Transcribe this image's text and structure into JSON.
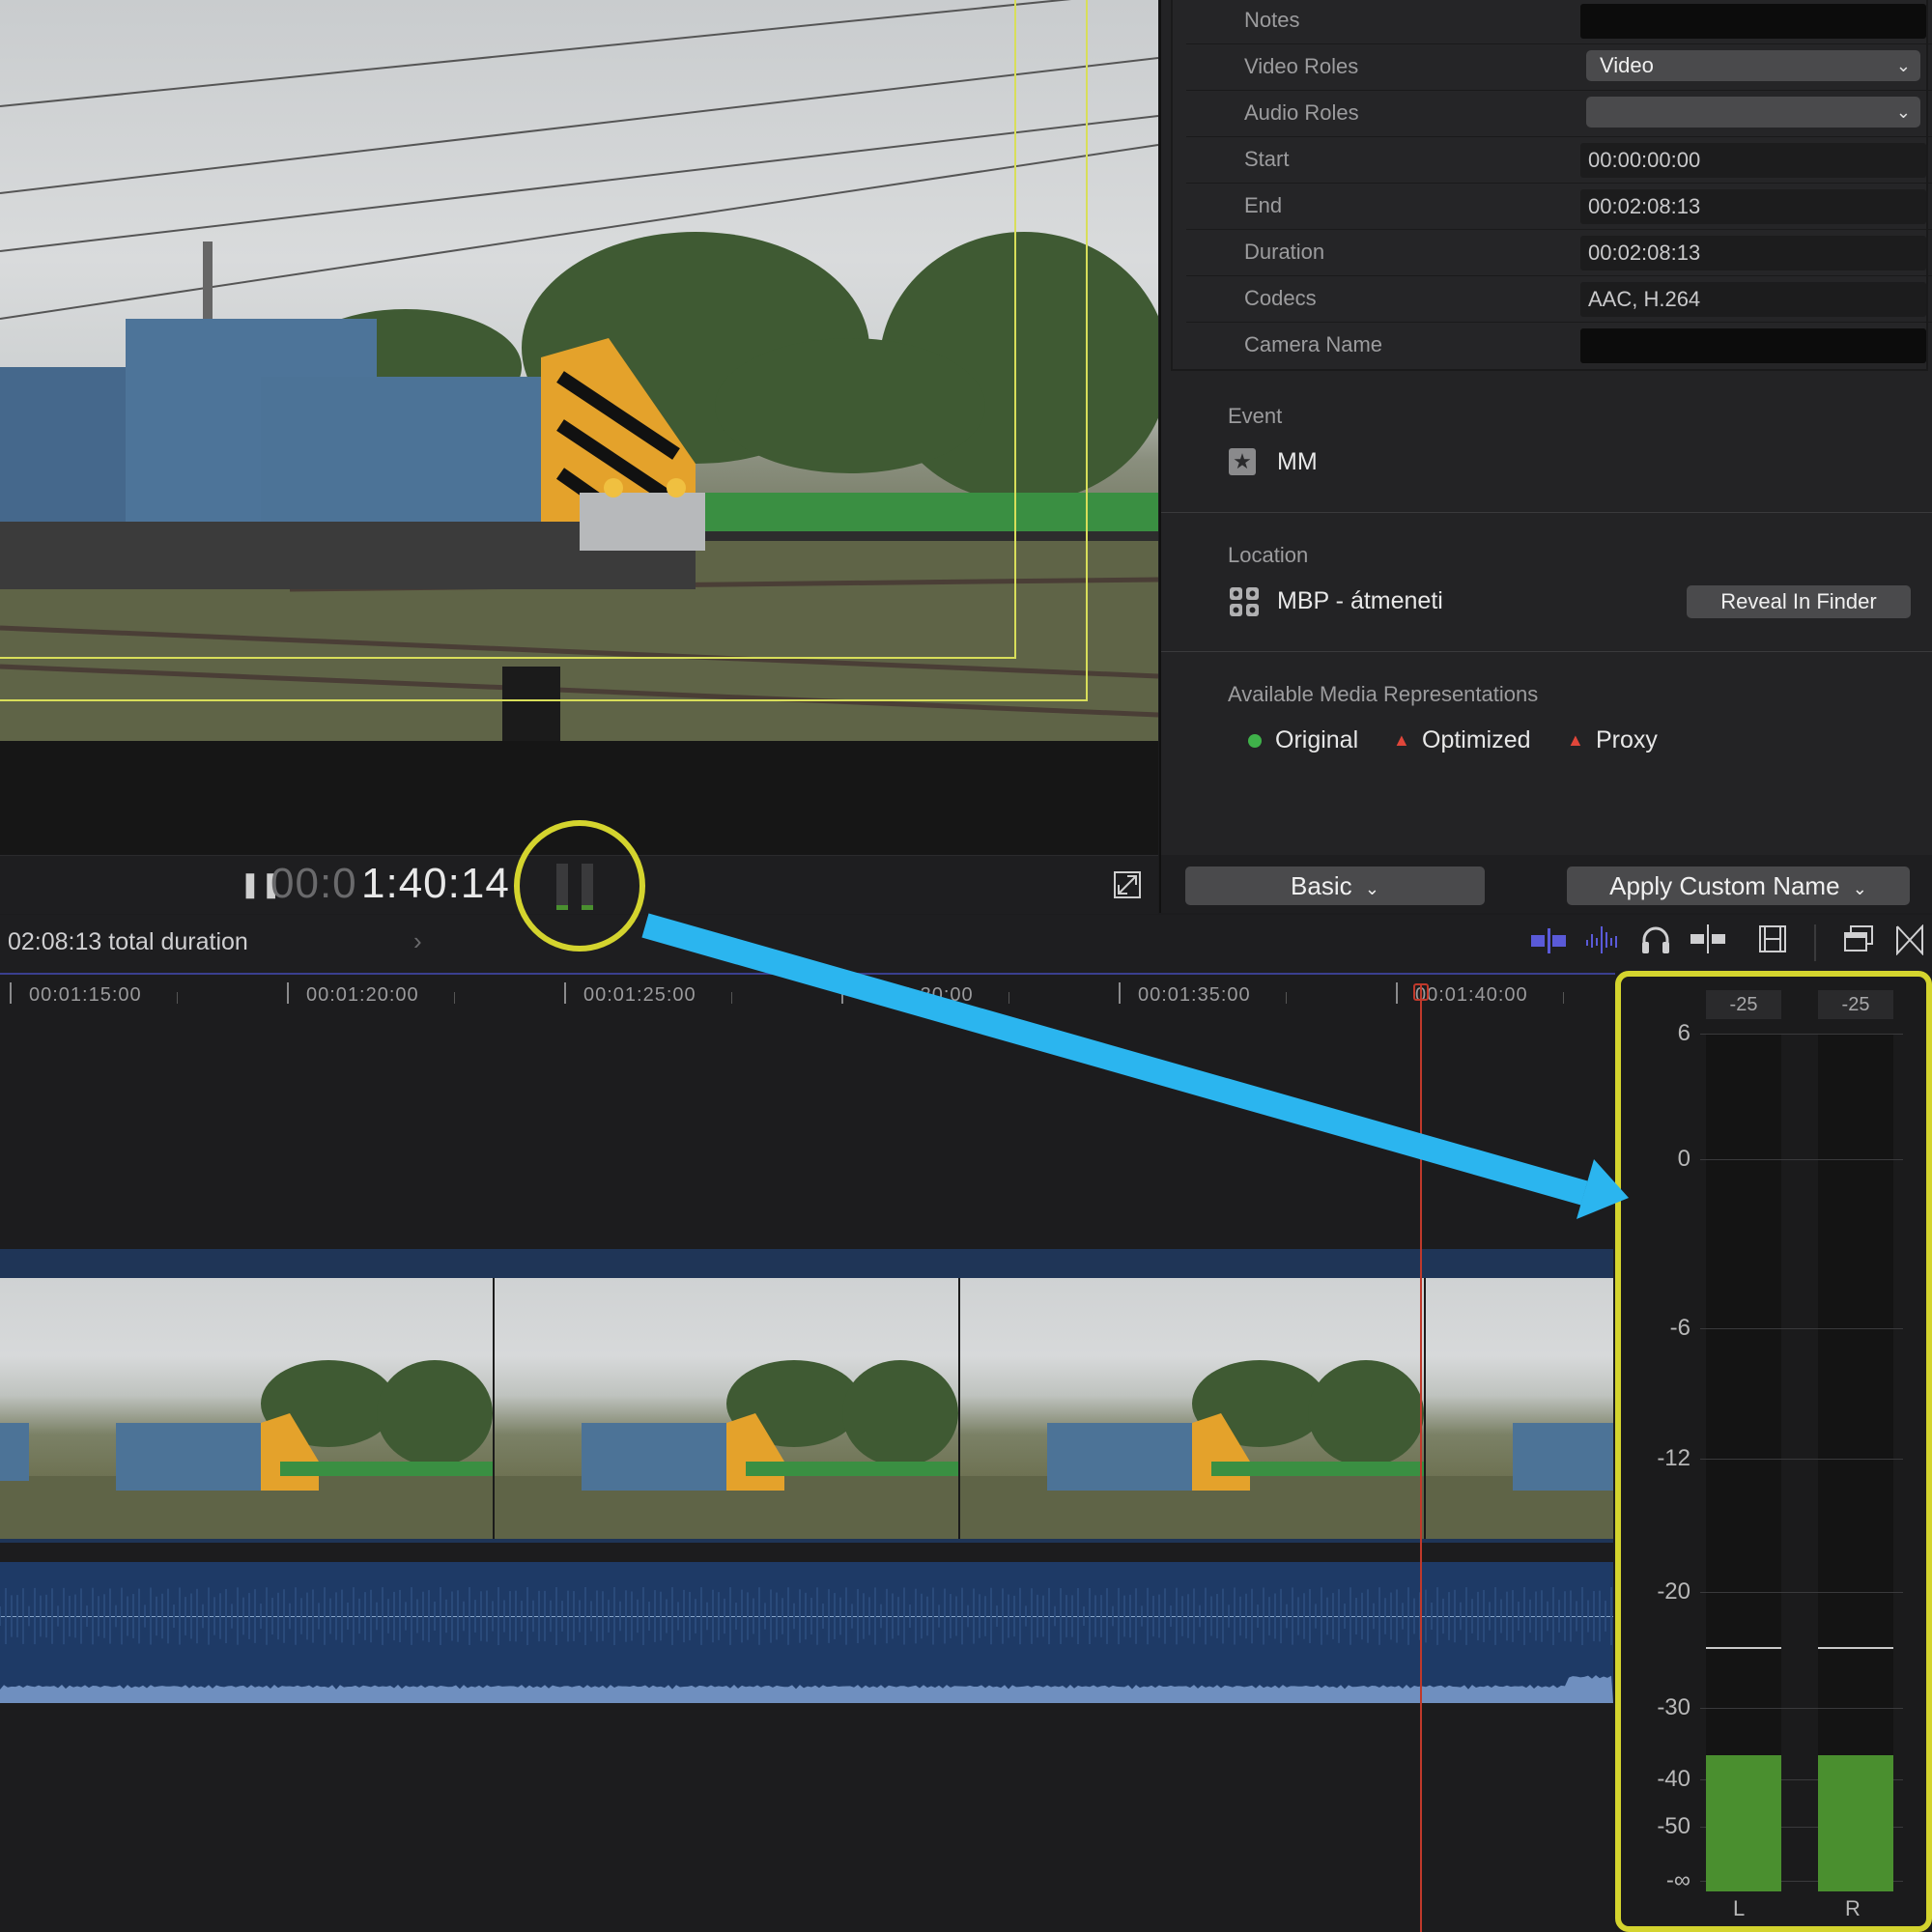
{
  "viewer": {
    "timecode_dim": "00:0",
    "timecode_bright": "1:40:14",
    "fit_icon": "expand-icon",
    "play_icon": "pause-icon"
  },
  "inspector": {
    "rows": [
      {
        "label": "Notes",
        "value": "",
        "kind": "dark"
      },
      {
        "label": "Video Roles",
        "value": "Video",
        "kind": "select"
      },
      {
        "label": "Audio Roles",
        "value": "",
        "kind": "select"
      },
      {
        "label": "Start",
        "value": "00:00:00:00",
        "kind": "field"
      },
      {
        "label": "End",
        "value": "00:02:08:13",
        "kind": "field"
      },
      {
        "label": "Duration",
        "value": "00:02:08:13",
        "kind": "field"
      },
      {
        "label": "Codecs",
        "value": "AAC, H.264",
        "kind": "field"
      },
      {
        "label": "Camera Name",
        "value": "",
        "kind": "dark"
      }
    ],
    "event": {
      "title": "Event",
      "name": "MM"
    },
    "location": {
      "title": "Location",
      "name": "MBP - átmeneti",
      "button": "Reveal In Finder"
    },
    "representations": {
      "title": "Available Media Representations",
      "items": [
        {
          "label": "Original",
          "status": "available",
          "color": "#3fb24a"
        },
        {
          "label": "Optimized",
          "status": "missing",
          "color": "#e0463a"
        },
        {
          "label": "Proxy",
          "status": "missing",
          "color": "#e0463a"
        }
      ]
    },
    "footer": {
      "basic": "Basic",
      "apply": "Apply Custom Name"
    }
  },
  "timeline": {
    "duration_text": "02:08:13 total duration",
    "ruler": [
      "00:01:15:00",
      "00:01:20:00",
      "00:01:25:00",
      "00:01:30:00",
      "00:01:35:00",
      "00:01:40:00"
    ],
    "toolbar_icons": [
      "clip-appearance-icon",
      "audio-skimming-icon",
      "headphones-icon",
      "snapping-icon",
      "filmstrip-icon",
      "window-icon",
      "transitions-icon"
    ]
  },
  "meters": {
    "peak_labels": [
      "-25",
      "-25"
    ],
    "channels": [
      "L",
      "R"
    ],
    "scale": [
      "6",
      "0",
      "-6",
      "-12",
      "-20",
      "-30",
      "-40",
      "-50",
      "-∞"
    ],
    "level_db": [
      -40,
      -40
    ],
    "peak_db": [
      -25,
      -25
    ],
    "accent": "#d4d42e",
    "level_color": "#4a8f2f"
  },
  "annotation": {
    "arrow_color": "#2bb5ef",
    "circle_color": "#d4d42e"
  }
}
